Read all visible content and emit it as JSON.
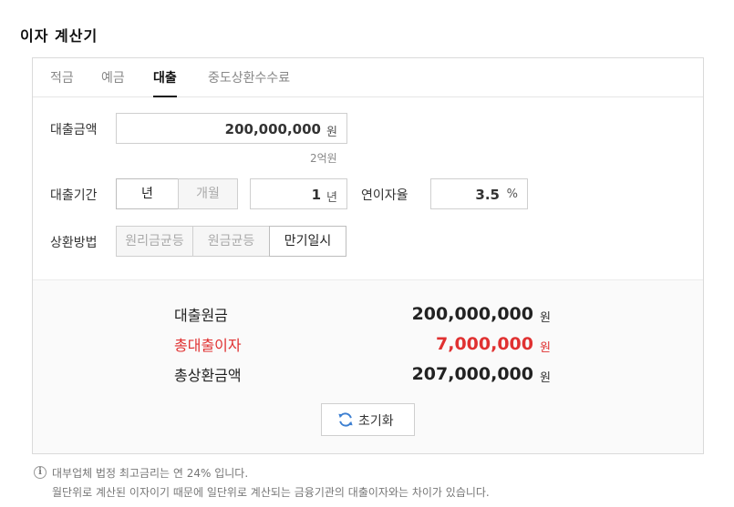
{
  "page_title": "이자 계산기",
  "tabs": [
    {
      "label": "적금",
      "active": false
    },
    {
      "label": "예금",
      "active": false
    },
    {
      "label": "대출",
      "active": true
    },
    {
      "label": "중도상환수수료",
      "active": false
    }
  ],
  "form": {
    "amount_label": "대출금액",
    "amount_value": "200,000,000",
    "amount_unit": "원",
    "amount_hint": "2억원",
    "period_label": "대출기간",
    "period_unit_options": [
      {
        "label": "년",
        "selected": true
      },
      {
        "label": "개월",
        "selected": false
      }
    ],
    "period_value": "1",
    "period_value_unit": "년",
    "rate_label": "연이자율",
    "rate_value": "3.5",
    "rate_unit": "%",
    "method_label": "상환방법",
    "method_options": [
      {
        "label": "원리금균등",
        "selected": false
      },
      {
        "label": "원금균등",
        "selected": false
      },
      {
        "label": "만기일시",
        "selected": true
      }
    ]
  },
  "result": {
    "principal_label": "대출원금",
    "principal_value": "200,000,000",
    "interest_label": "총대출이자",
    "interest_value": "7,000,000",
    "total_label": "총상환금액",
    "total_value": "207,000,000",
    "unit": "원",
    "reset_label": "초기화"
  },
  "notes": {
    "line1": "대부업체 법정 최고금리는 연 24% 입니다.",
    "line2": "월단위로 계산된 이자이기 때문에 일단위로 계산되는 금융기관의 대출이자와는 차이가 있습니다."
  },
  "colors": {
    "accent_red": "#e03131",
    "reset_icon_blue": "#3d7fd1"
  }
}
